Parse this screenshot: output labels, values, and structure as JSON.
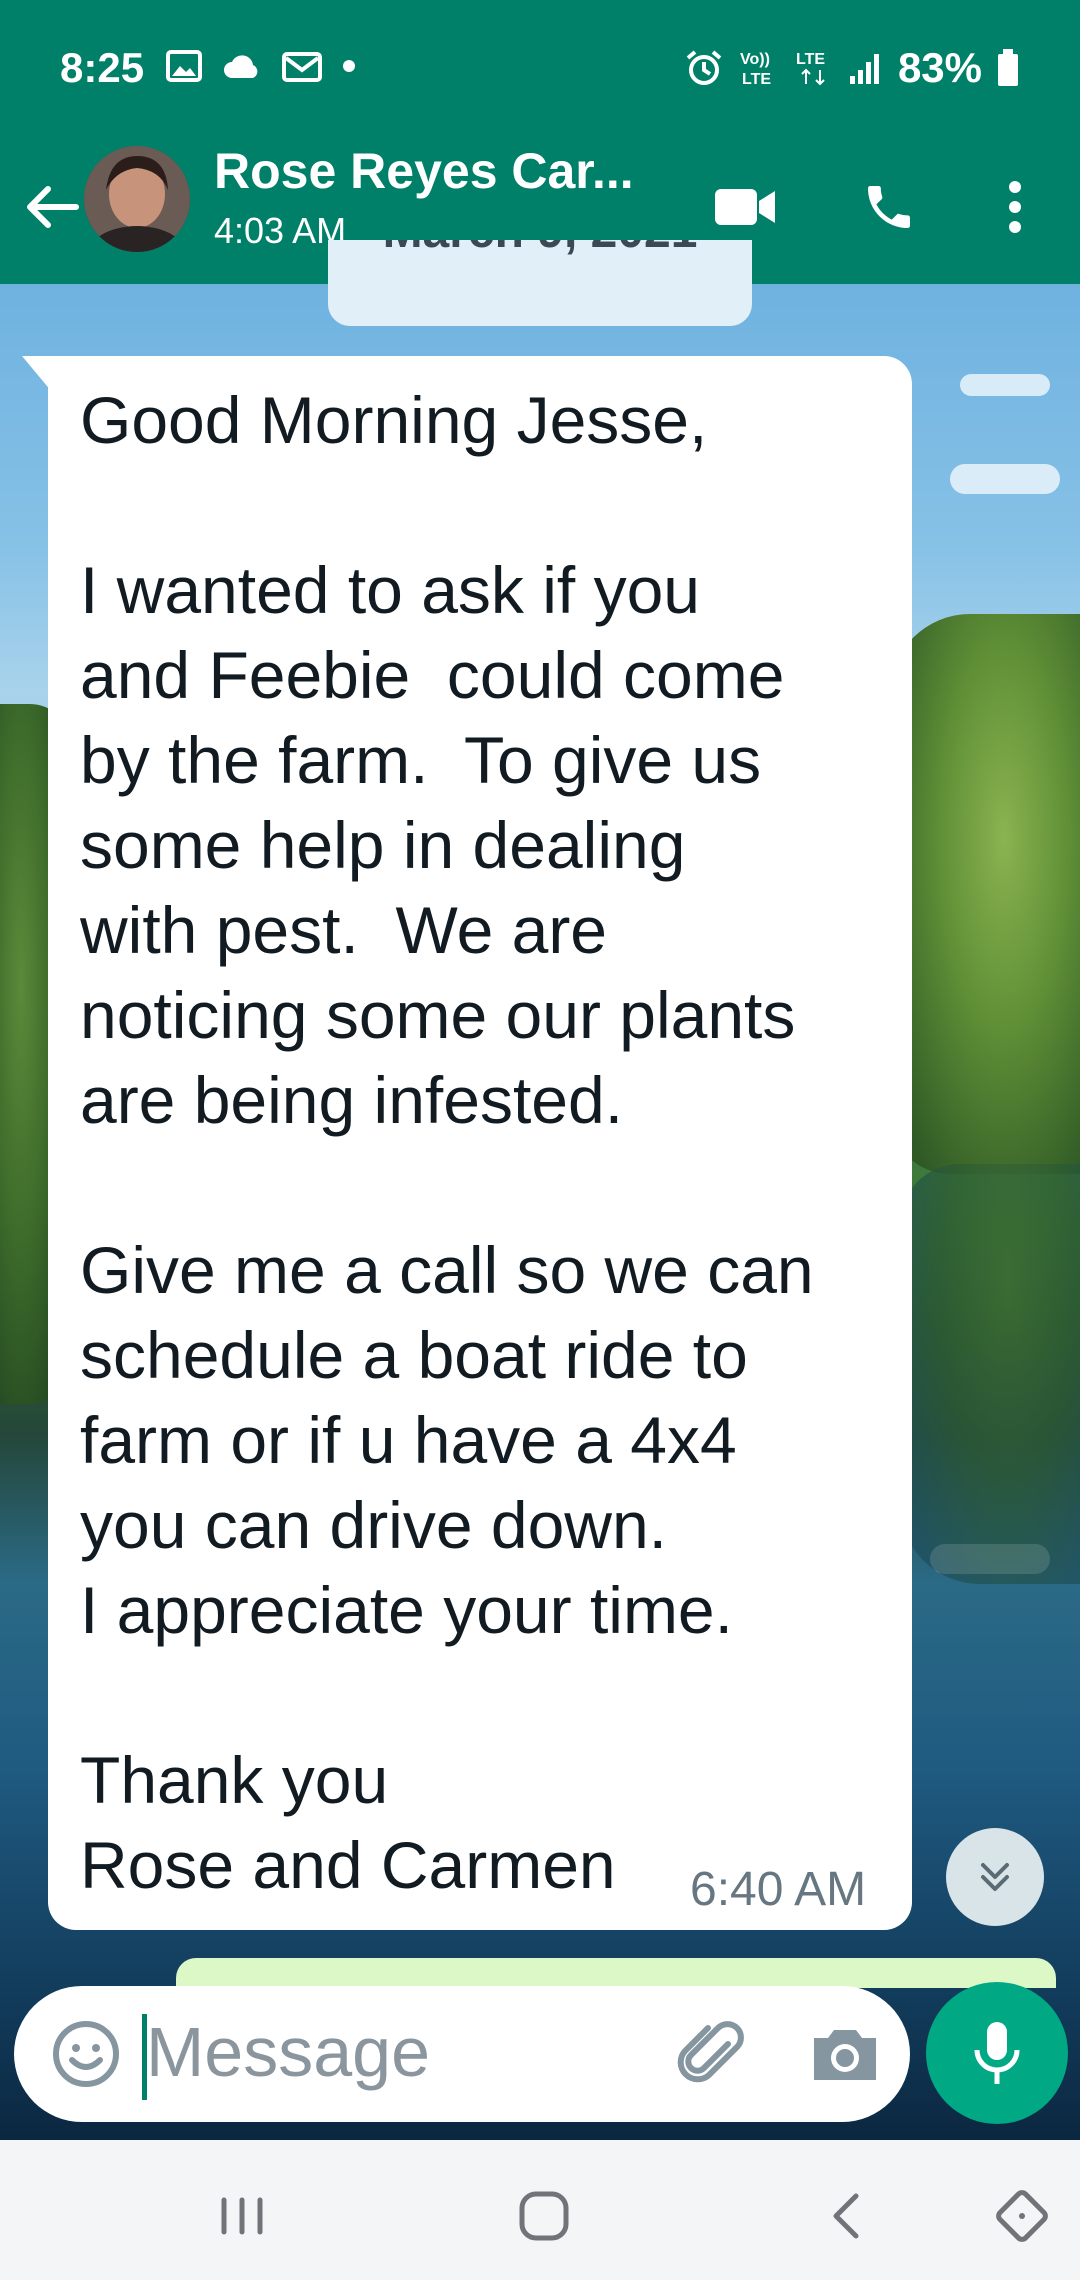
{
  "status_bar": {
    "time": "8:25",
    "left_icons": [
      "image-icon",
      "cloud-icon",
      "mail-icon",
      "dot-icon"
    ],
    "right_icons": [
      "alarm-icon",
      "volte-icon",
      "lte-icon",
      "signal-icon"
    ],
    "battery": "83%"
  },
  "header": {
    "contact_name": "Rose Reyes Car...",
    "subtitle": "4:03 AM",
    "icons": [
      "back-arrow-icon",
      "video-call-icon",
      "phone-icon",
      "more-vert-icon"
    ]
  },
  "chat": {
    "date_chip": "March 9, 2021",
    "message": {
      "text": "Good Morning Jesse,\n\nI wanted to ask if you\nand Feebie  could come\nby the farm.  To give us\nsome help in dealing\nwith pest.  We are\nnoticing some our plants\nare being infested.\n\nGive me a call so we can\nschedule a boat ride to\nfarm or if u have a 4x4\nyou can drive down.\nI appreciate your time.\n\nThank you\nRose and Carmen",
      "time": "6:40 AM"
    }
  },
  "composer": {
    "placeholder": "Message"
  },
  "colors": {
    "header": "#008069",
    "mic_button": "#00a884",
    "bubble": "#ffffff"
  }
}
